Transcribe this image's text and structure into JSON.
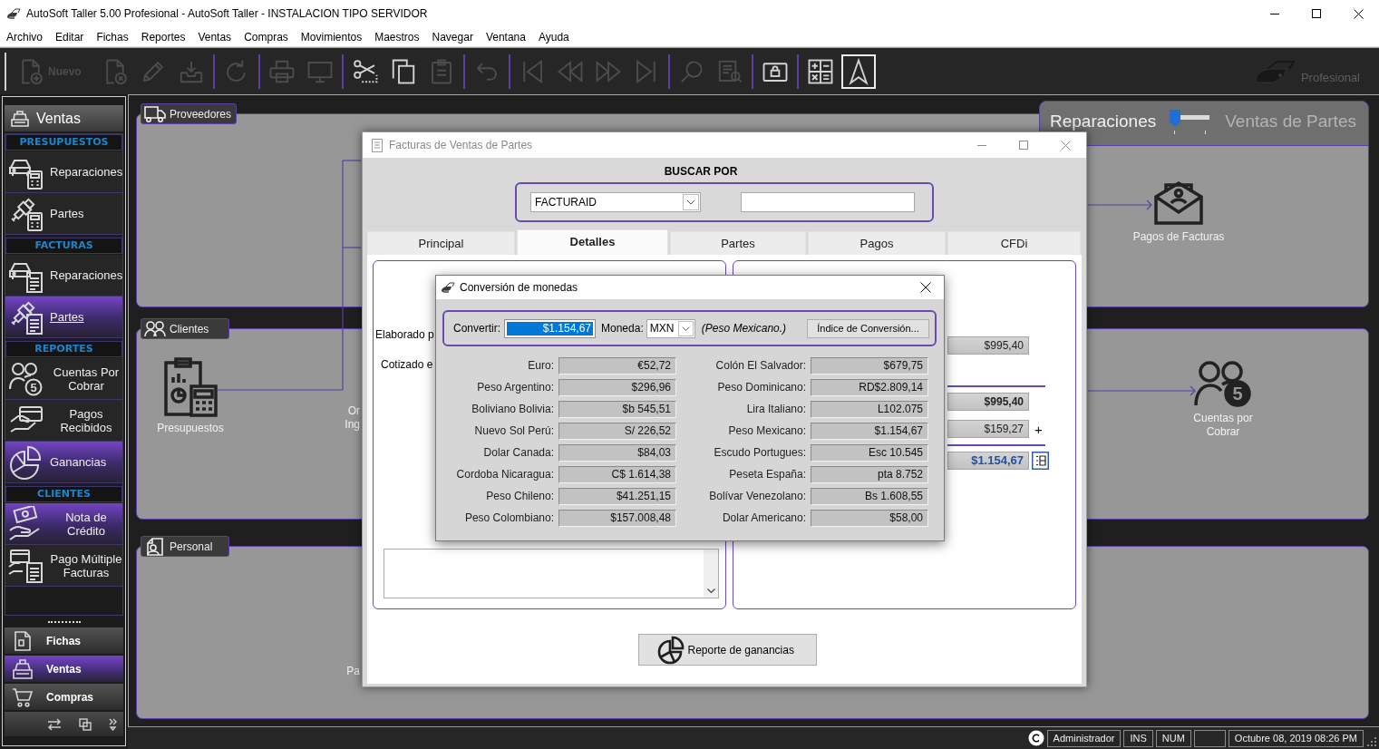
{
  "window": {
    "title": "AutoSoft Taller 5.00 Profesional - AutoSoft Taller - INSTALACION TIPO SERVIDOR"
  },
  "menu": [
    "Archivo",
    "Editar",
    "Fichas",
    "Reportes",
    "Ventas",
    "Compras",
    "Movimientos",
    "Maestros",
    "Navegar",
    "Ventana",
    "Ayuda"
  ],
  "toolbar": {
    "groups": [
      [
        {
          "kind": "new-doc",
          "label": "Nuevo",
          "disabled": true,
          "pressed": false
        },
        {
          "kind": "delete-doc",
          "disabled": true,
          "pressed": false
        },
        {
          "kind": "pencil",
          "disabled": true,
          "pressed": false
        },
        {
          "kind": "save",
          "disabled": true,
          "pressed": false
        }
      ],
      [
        {
          "kind": "refresh",
          "disabled": true,
          "pressed": false
        }
      ],
      [
        {
          "kind": "printer",
          "disabled": true,
          "pressed": false
        },
        {
          "kind": "monitor",
          "disabled": true,
          "pressed": false
        }
      ],
      [
        {
          "kind": "cut",
          "disabled": false,
          "pressed": false
        },
        {
          "kind": "copy",
          "disabled": false,
          "pressed": false
        },
        {
          "kind": "paste",
          "disabled": true,
          "pressed": false
        }
      ],
      [
        {
          "kind": "undo",
          "disabled": true,
          "pressed": false
        }
      ],
      [
        {
          "kind": "first",
          "disabled": true,
          "pressed": false
        },
        {
          "kind": "rewind",
          "disabled": true,
          "pressed": false
        },
        {
          "kind": "forward",
          "disabled": true,
          "pressed": false
        },
        {
          "kind": "last",
          "disabled": true,
          "pressed": false
        }
      ],
      [
        {
          "kind": "search",
          "disabled": true,
          "pressed": false
        },
        {
          "kind": "report",
          "disabled": true,
          "pressed": false
        }
      ],
      [
        {
          "kind": "lock",
          "disabled": false,
          "pressed": false
        }
      ],
      [
        {
          "kind": "calculator",
          "disabled": false,
          "pressed": false
        },
        {
          "kind": "navigation",
          "disabled": false,
          "pressed": true
        }
      ]
    ],
    "edition": "Profesional"
  },
  "sidebar": {
    "title": "Ventas",
    "sections": [
      {
        "heading": "PRESUPUESTOS",
        "items": [
          {
            "kind": "car-calc",
            "label": "Reparaciones",
            "selected": false,
            "highlighted": false
          },
          {
            "kind": "plug-calc",
            "label": "Partes",
            "selected": false,
            "highlighted": false
          }
        ]
      },
      {
        "heading": "FACTURAS",
        "items": [
          {
            "kind": "car-doc",
            "label": "Reparaciones",
            "selected": false,
            "highlighted": false
          },
          {
            "kind": "plug-doc",
            "label": "Partes",
            "selected": true,
            "highlighted": true
          }
        ]
      },
      {
        "heading": "REPORTES",
        "items": [
          {
            "kind": "people-badge",
            "label": "Cuentas Por Cobrar",
            "badge": "5",
            "selected": false,
            "highlighted": false
          },
          {
            "kind": "hand-card",
            "label": "Pagos Recibidos",
            "selected": false,
            "highlighted": false
          },
          {
            "kind": "pie",
            "label": "Ganancias",
            "selected": false,
            "highlighted": true
          }
        ]
      },
      {
        "heading": "CLIENTES",
        "items": [
          {
            "kind": "hand-money",
            "label": "Nota de Crédito",
            "selected": false,
            "highlighted": true
          },
          {
            "kind": "card-doc",
            "label": "Pago Múltiple Facturas",
            "selected": false,
            "highlighted": false
          }
        ]
      }
    ],
    "nav": [
      {
        "kind": "doc",
        "label": "Fichas",
        "selected": false
      },
      {
        "kind": "register",
        "label": "Ventas",
        "selected": true
      },
      {
        "kind": "cart",
        "label": "Compras",
        "selected": false
      }
    ]
  },
  "dashboard": {
    "switch": {
      "options": [
        {
          "label": "Reparaciones",
          "selected": true
        },
        {
          "label": "Ventas de Partes",
          "selected": false
        }
      ]
    },
    "panels": [
      {
        "kind": "truck",
        "title": "Proveedores",
        "nodes": [
          {
            "kind": "envelope-money",
            "label": "Pagos de Facturas"
          }
        ]
      },
      {
        "kind": "people",
        "title": "Clientes",
        "nodes": [
          {
            "kind": "clipboard-calc",
            "label": "Presupuestos"
          },
          {
            "kind": "text",
            "label": "Or"
          },
          {
            "kind": "text",
            "label": "Ing"
          },
          {
            "kind": "people-badge",
            "label": "Cuentas por Cobrar",
            "badge": "5"
          }
        ]
      },
      {
        "kind": "person-doc",
        "title": "Personal",
        "nodes": [
          {
            "kind": "text",
            "label": "Pa"
          }
        ]
      }
    ]
  },
  "invoice_window": {
    "title": "Facturas de Ventas de Partes",
    "search": {
      "heading": "BUSCAR POR",
      "field": "FACTURAID"
    },
    "tabs": [
      {
        "label": "Principal",
        "selected": false
      },
      {
        "label": "Detalles",
        "selected": true
      },
      {
        "label": "Partes",
        "selected": false
      },
      {
        "label": "Pagos",
        "selected": false
      },
      {
        "label": "CFDi",
        "selected": false
      }
    ],
    "labels": [
      "Elaborado p",
      "Cotizado e"
    ],
    "amounts": [
      {
        "kind": "plain",
        "value": "$995,40",
        "rule_before": false
      },
      {
        "kind": "bold",
        "value": "$995,40",
        "rule_before": true
      },
      {
        "kind": "plain",
        "value": "$159,27",
        "suffix": "+",
        "rule_before": false
      },
      {
        "kind": "total",
        "value": "$1.154,67",
        "rule_before": true
      }
    ],
    "report_button": "Reporte de ganancias"
  },
  "conversion_dialog": {
    "title": "Conversión de monedas",
    "convert_label": "Convertir:",
    "amount": "$1.154,67",
    "currency_label": "Moneda:",
    "currency": "MXN",
    "currency_name": "(Peso Mexicano.)",
    "rates_button": "Índice de Conversión...",
    "columns": [
      [
        {
          "label": "Euro:",
          "value": "€52,72"
        },
        {
          "label": "Peso Argentino:",
          "value": "$296,96"
        },
        {
          "label": "Boliviano Bolivia:",
          "value": "$b 545,51"
        },
        {
          "label": "Nuevo Sol Perú:",
          "value": "S/ 226,52"
        },
        {
          "label": "Dolar Canada:",
          "value": "$84,03"
        },
        {
          "label": "Cordoba Nicaragua:",
          "value": "C$ 1.614,38"
        },
        {
          "label": "Peso Chileno:",
          "value": "$41.251,15"
        },
        {
          "label": "Peso Colombiano:",
          "value": "$157.008,48"
        }
      ],
      [
        {
          "label": "Colón El Salvador:",
          "value": "$679,75"
        },
        {
          "label": "Peso Dominicano:",
          "value": "RD$2.809,14"
        },
        {
          "label": "Lira Italiano:",
          "value": "L102.075"
        },
        {
          "label": "Peso Mexicano:",
          "value": "$1.154,67"
        },
        {
          "label": "Escudo Portugues:",
          "value": "Esc 10.545"
        },
        {
          "label": "Peseta España:",
          "value": "pta 8.752"
        },
        {
          "label": "Bolívar Venezolano:",
          "value": "Bs 1.608,55"
        },
        {
          "label": "Dolar Americano:",
          "value": "$58,00"
        }
      ]
    ]
  },
  "status_bar": {
    "user": "Administrador",
    "keys": [
      "INS",
      "NUM"
    ],
    "datetime": "Octubre 08, 2019 08:26 PM"
  }
}
